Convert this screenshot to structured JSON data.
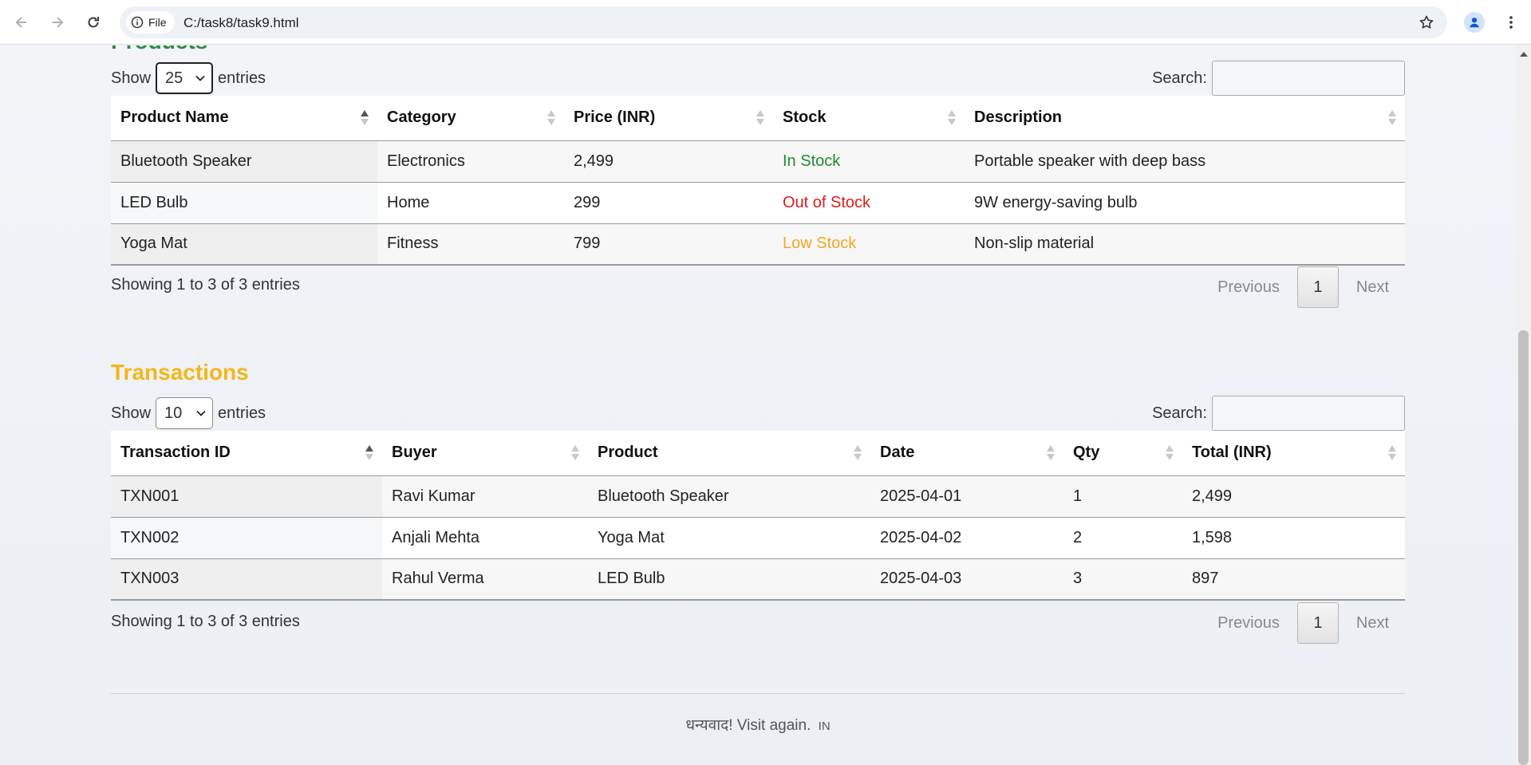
{
  "browser": {
    "site_chip_label": "File",
    "url": "C:/task8/task9.html"
  },
  "products": {
    "title": "Products",
    "show_label": "Show",
    "length_value": "25",
    "entries_label": "entries",
    "search_label": "Search:",
    "search_value": "",
    "columns": [
      "Product Name",
      "Category",
      "Price (INR)",
      "Stock",
      "Description"
    ],
    "rows": [
      {
        "name": "Bluetooth Speaker",
        "category": "Electronics",
        "price": "2,499",
        "stock": "In Stock",
        "description": "Portable speaker with deep bass"
      },
      {
        "name": "LED Bulb",
        "category": "Home",
        "price": "299",
        "stock": "Out of Stock",
        "description": "9W energy-saving bulb"
      },
      {
        "name": "Yoga Mat",
        "category": "Fitness",
        "price": "799",
        "stock": "Low Stock",
        "description": "Non-slip material"
      }
    ],
    "info": "Showing 1 to 3 of 3 entries",
    "previous": "Previous",
    "page": "1",
    "next": "Next"
  },
  "transactions": {
    "title": "Transactions",
    "show_label": "Show",
    "length_value": "10",
    "entries_label": "entries",
    "search_label": "Search:",
    "search_value": "",
    "columns": [
      "Transaction ID",
      "Buyer",
      "Product",
      "Date",
      "Qty",
      "Total (INR)"
    ],
    "rows": [
      {
        "id": "TXN001",
        "buyer": "Ravi Kumar",
        "product": "Bluetooth Speaker",
        "date": "2025-04-01",
        "qty": "1",
        "total": "2,499"
      },
      {
        "id": "TXN002",
        "buyer": "Anjali Mehta",
        "product": "Yoga Mat",
        "date": "2025-04-02",
        "qty": "2",
        "total": "1,598"
      },
      {
        "id": "TXN003",
        "buyer": "Rahul Verma",
        "product": "LED Bulb",
        "date": "2025-04-03",
        "qty": "3",
        "total": "897"
      }
    ],
    "info": "Showing 1 to 3 of 3 entries",
    "previous": "Previous",
    "page": "1",
    "next": "Next"
  },
  "footer": {
    "text": "धन्यवाद! Visit again.",
    "flag": "IN"
  },
  "colors": {
    "products_title": "#2e8b3e",
    "transactions_title": "#f2b71b",
    "in_stock": "#1e8a2e",
    "out_of_stock": "#e01b1b",
    "low_stock": "#f5a623"
  },
  "icons": [
    "back-arrow-icon",
    "forward-arrow-icon",
    "reload-icon",
    "info-icon",
    "star-icon",
    "profile-icon",
    "kebab-menu-icon",
    "chevron-down-icon",
    "sort-icon"
  ]
}
